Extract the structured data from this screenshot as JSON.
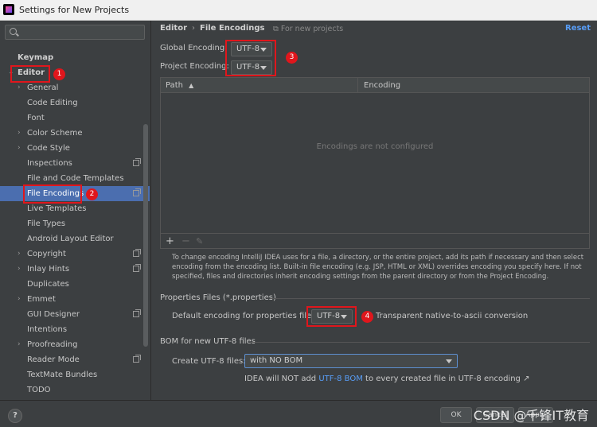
{
  "window": {
    "title": "Settings for New Projects"
  },
  "sidebar": {
    "items": [
      {
        "label": "Keymap"
      },
      {
        "label": "Editor"
      },
      {
        "label": "General"
      },
      {
        "label": "Code Editing"
      },
      {
        "label": "Font"
      },
      {
        "label": "Color Scheme"
      },
      {
        "label": "Code Style"
      },
      {
        "label": "Inspections"
      },
      {
        "label": "File and Code Templates"
      },
      {
        "label": "File Encodings"
      },
      {
        "label": "Live Templates"
      },
      {
        "label": "File Types"
      },
      {
        "label": "Android Layout Editor"
      },
      {
        "label": "Copyright"
      },
      {
        "label": "Inlay Hints"
      },
      {
        "label": "Duplicates"
      },
      {
        "label": "Emmet"
      },
      {
        "label": "GUI Designer"
      },
      {
        "label": "Intentions"
      },
      {
        "label": "Proofreading"
      },
      {
        "label": "Reader Mode"
      },
      {
        "label": "TextMate Bundles"
      },
      {
        "label": "TODO"
      }
    ],
    "selected": "File Encodings"
  },
  "breadcrumb": {
    "parent": "Editor",
    "current": "File Encodings"
  },
  "scope_note": "For new projects",
  "reset_label": "Reset",
  "global_encoding": {
    "label": "Global Encoding:",
    "value": "UTF-8"
  },
  "project_encoding": {
    "label": "Project Encoding:",
    "value": "UTF-8"
  },
  "table": {
    "columns": [
      "Path",
      "Encoding"
    ],
    "sort_indicator": "▲",
    "empty_text": "Encodings are not configured",
    "tools": [
      "+",
      "−",
      "✎"
    ]
  },
  "help_text": "To change encoding IntelliJ IDEA uses for a file, a directory, or the entire project, add its path if necessary and then select encoding from the encoding list. Built-in file encoding (e.g. JSP, HTML or XML) overrides encoding you specify here. If not specified, files and directories inherit encoding settings from the parent directory or from the Project Encoding.",
  "properties": {
    "section_title": "Properties Files (*.properties)",
    "default_label": "Default encoding for properties files:",
    "default_value": "UTF-8",
    "checkbox_label": "Transparent native-to-ascii conversion"
  },
  "bom": {
    "section_title": "BOM for new UTF-8 files",
    "create_label": "Create UTF-8 files:",
    "create_value": "with NO BOM",
    "note_prefix": "IDEA will NOT add ",
    "note_link": "UTF-8 BOM",
    "note_suffix": " to every created file in UTF-8 encoding ↗"
  },
  "annotations": [
    "1",
    "2",
    "3",
    "4"
  ],
  "footer": {
    "help": "?",
    "ok": "OK",
    "cancel": "Cancel",
    "apply": "Apply",
    "watermark": "CSDN @千锋IT教育"
  },
  "colors": {
    "background": "#3c3f41",
    "selection": "#4b6eaf",
    "link": "#589df6",
    "annotation": "#e0161c"
  }
}
